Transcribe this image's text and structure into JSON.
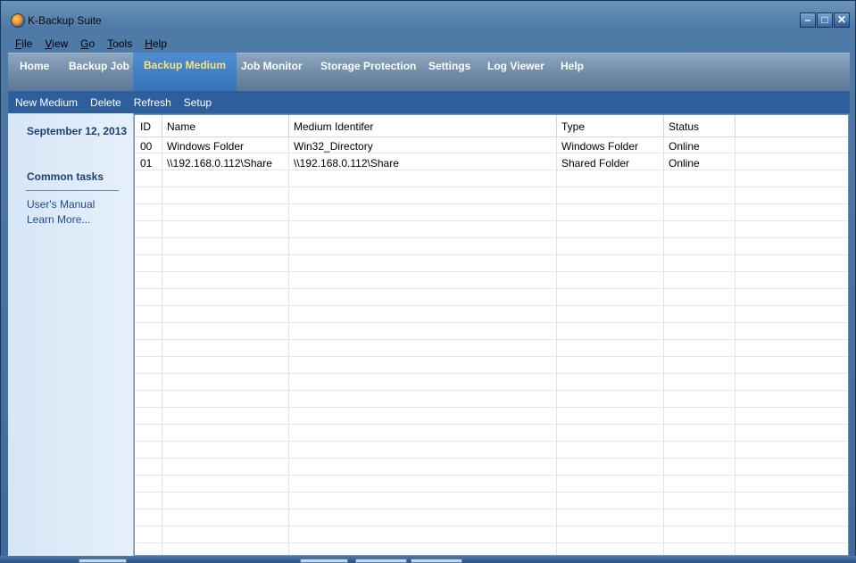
{
  "window": {
    "title": "K-Backup Suite"
  },
  "menu": [
    {
      "accel": "F",
      "rest": "ile"
    },
    {
      "accel": "V",
      "rest": "iew"
    },
    {
      "accel": "G",
      "rest": "o"
    },
    {
      "accel": "T",
      "rest": "ools"
    },
    {
      "accel": "H",
      "rest": "elp"
    }
  ],
  "nav": {
    "tabs": [
      "Home",
      "Backup Job",
      "Backup Medium",
      "Job Monitor",
      "Storage Protection",
      "Settings",
      "Log Viewer",
      "Help"
    ],
    "active": "Backup Medium"
  },
  "toolbar": [
    "New Medium",
    "Delete",
    "Refresh",
    "Setup"
  ],
  "sidebar": {
    "date": "September 12, 2013",
    "common_tasks": "Common tasks",
    "links": [
      "User's Manual",
      "Learn More..."
    ]
  },
  "table": {
    "columns": [
      "ID",
      "Name",
      "Medium Identifer",
      "Type",
      "Status"
    ],
    "rows": [
      [
        "00",
        "Windows Folder",
        "Win32_Directory",
        "Windows Folder",
        "Online"
      ],
      [
        "01",
        "\\\\192.168.0.112\\Share",
        "\\\\192.168.0.112\\Share",
        "Shared Folder",
        "Online"
      ]
    ]
  },
  "colors": {
    "accent": "#2f5e9c",
    "active_tab_text": "#ffe27a"
  }
}
